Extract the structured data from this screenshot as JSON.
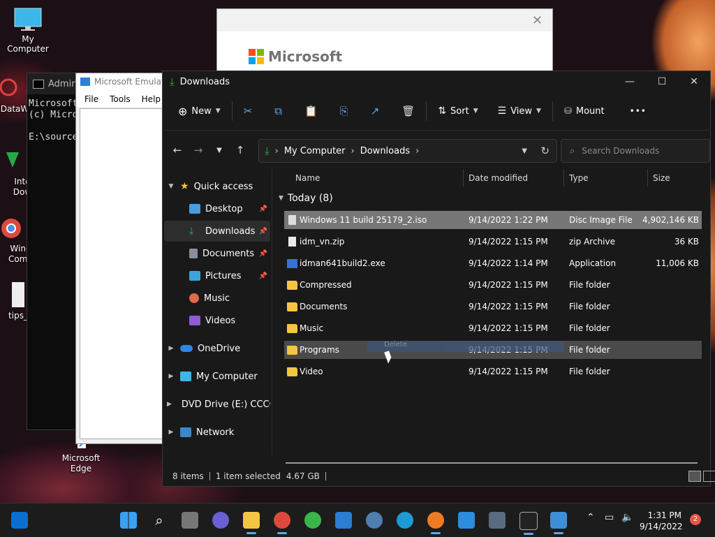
{
  "desktop": {
    "icons": [
      {
        "label": "My Computer"
      },
      {
        "label": "DataW"
      },
      {
        "label": "Inte"
      },
      {
        "label": "Dow"
      },
      {
        "label": "Winc"
      },
      {
        "label": "Compa"
      },
      {
        "label": "tips_"
      },
      {
        "label": "Microsoft"
      },
      {
        "label": "Edge"
      }
    ]
  },
  "cmd": {
    "title": "Admin",
    "lines": [
      "Microsoft",
      "(c) Micro",
      "",
      "E:\\source"
    ]
  },
  "emulator": {
    "title": "Microsoft Emulato",
    "menu": [
      "File",
      "Tools",
      "Help"
    ]
  },
  "ms_dialog": {
    "brand": "Microsoft",
    "close": "✕"
  },
  "explorer": {
    "title": "Downloads",
    "controls": {
      "min": "—",
      "max": "☐",
      "close": "✕"
    },
    "toolbar": {
      "new": "New",
      "sort": "Sort",
      "view": "View",
      "mount": "Mount",
      "more": "•••"
    },
    "address": {
      "crumbs": [
        "My Computer",
        "Downloads"
      ],
      "search_placeholder": "Search Downloads"
    },
    "nav": {
      "quick_access": "Quick access",
      "items": [
        {
          "label": "Desktop",
          "pinned": true
        },
        {
          "label": "Downloads",
          "pinned": true
        },
        {
          "label": "Documents",
          "pinned": true
        },
        {
          "label": "Pictures",
          "pinned": true
        },
        {
          "label": "Music",
          "pinned": false
        },
        {
          "label": "Videos",
          "pinned": false
        }
      ],
      "onedrive": "OneDrive",
      "my_computer": "My Computer",
      "dvd": "DVD Drive (E:) CCCC",
      "network": "Network"
    },
    "columns": {
      "name": "Name",
      "date": "Date modified",
      "type": "Type",
      "size": "Size"
    },
    "group": "Today (8)",
    "files": [
      {
        "name": "Windows 11 build 25179_2.iso",
        "date": "9/14/2022 1:22 PM",
        "type": "Disc Image File",
        "size": "4,902,146 KB",
        "icon": "disc-image-icon"
      },
      {
        "name": "idm_vn.zip",
        "date": "9/14/2022 1:15 PM",
        "type": "zip Archive",
        "size": "36 KB",
        "icon": "zip-file-icon"
      },
      {
        "name": "idman641build2.exe",
        "date": "9/14/2022 1:14 PM",
        "type": "Application",
        "size": "11,006 KB",
        "icon": "application-icon"
      },
      {
        "name": "Compressed",
        "date": "9/14/2022 1:15 PM",
        "type": "File folder",
        "size": "",
        "icon": "folder-icon"
      },
      {
        "name": "Documents",
        "date": "9/14/2022 1:15 PM",
        "type": "File folder",
        "size": "",
        "icon": "folder-icon"
      },
      {
        "name": "Music",
        "date": "9/14/2022 1:15 PM",
        "type": "File folder",
        "size": "",
        "icon": "folder-icon"
      },
      {
        "name": "Programs",
        "date": "9/14/2022 1:15 PM",
        "type": "File folder",
        "size": "",
        "icon": "folder-icon"
      },
      {
        "name": "Video",
        "date": "9/14/2022 1:15 PM",
        "type": "File folder",
        "size": "",
        "icon": "folder-icon"
      }
    ],
    "drag_label": "Delete",
    "status": {
      "items": "8 items",
      "selected": "1 item selected",
      "size": "4.67 GB"
    }
  },
  "taskbar": {
    "time": "1:31 PM",
    "date": "9/14/2022",
    "notifications": "2"
  },
  "colors": {
    "accent": "#62a8ef",
    "folder": "#f4c542",
    "selection": "#777777"
  }
}
